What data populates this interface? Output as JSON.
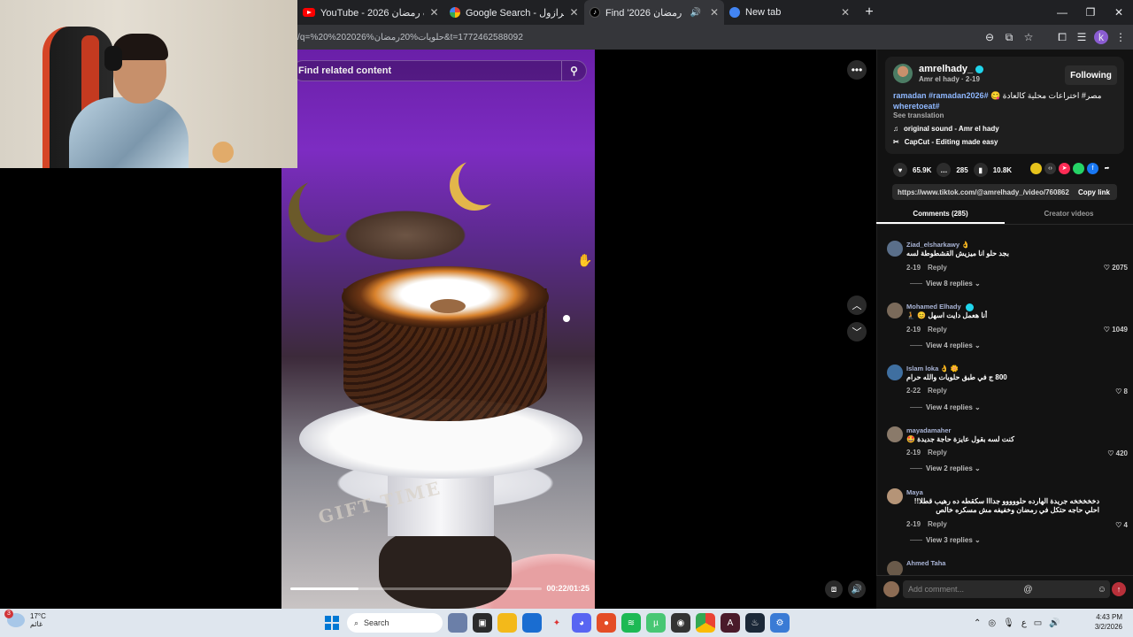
{
  "browser": {
    "tabs": [
      {
        "title": "YouTube - 2026 حلويات رمضان",
        "icon": "youtube-icon",
        "active": false
      },
      {
        "title": "Google Search - داوني برازول",
        "icon": "google-icon",
        "active": false
      },
      {
        "title": "Find '2026 حلويات رمضان '",
        "icon": "tiktok-icon",
        "active": true
      },
      {
        "title": "New tab",
        "icon": "chrome-icon",
        "active": false
      }
    ],
    "url": "/q=%20%202026%حلويات%20رمضان&t=1772462588092"
  },
  "video": {
    "search_placeholder": "Find related content",
    "time": "00:22/01:25",
    "progress": 0.27,
    "overlay_text": "GIFT TIME"
  },
  "post": {
    "username": "amrelhady_",
    "subline": "Amr el hady · 2-19",
    "follow_label": "Following",
    "caption_text": "مصر# اختراعات محلية كالعادة 😋",
    "caption_tags": "#ramadan #ramadan2026",
    "caption_tag2": "#wheretoeat",
    "see_translation": "See translation",
    "sound": "original sound - Amr el hady",
    "capcut": "CapCut - Editing made easy",
    "likes": "65.9K",
    "comments_count": "285",
    "saves": "10.8K",
    "link": "https://www.tiktok.com/@amrelhady_/video/76086238...",
    "copy_link": "Copy link",
    "tab_comments": "Comments (285)",
    "tab_creator": "Creator videos"
  },
  "comments": [
    {
      "name": "Ziad_elsharkawy 👌",
      "text": "بجد حلو انا ميزيش القشطوطة لسه",
      "date": "2-19",
      "reply": "Reply",
      "likes": "2075",
      "view": "View 8 replies",
      "avatar_color": "#5a6f8a"
    },
    {
      "name": "Mohamed Elhady",
      "text": "أنا هعمل دايت اسهل 😊 🧎",
      "date": "2-19",
      "reply": "Reply",
      "likes": "1049",
      "view": "View 4 replies",
      "avatar_color": "#7a6a5a"
    },
    {
      "name": "Islam loka 👌 🌼",
      "text": "800 ج في طبق حلويات والله حرام",
      "date": "2-22",
      "reply": "Reply",
      "likes": "8",
      "view": "View 4 replies",
      "avatar_color": "#3f6fa0"
    },
    {
      "name": "mayadamaher",
      "text": "كنت لسه بقول عايزة حاجة جديدة 🤩",
      "date": "2-19",
      "reply": "Reply",
      "likes": "420",
      "view": "View 2 replies",
      "avatar_color": "#8a7a6a"
    },
    {
      "name": "Maya",
      "text": "دخخخخخه جريدة الهارده حلووووو جدااا سكقطه ده رهيب قطلا!! احلي حاجه حتكل في رمضان وخفيفه مش مسكره خالص",
      "date": "2-19",
      "reply": "Reply",
      "likes": "4",
      "view": "View 3 replies",
      "avatar_color": "#b59477"
    },
    {
      "name": "Ahmed Taha",
      "text": "",
      "date": "",
      "reply": "",
      "likes": "",
      "view": "",
      "avatar_color": "#6a5a4a"
    }
  ],
  "add_comment_placeholder": "Add comment...",
  "taskbar": {
    "temp": "17°C",
    "weather_label": "غائم",
    "weather_badge": "3",
    "search_label": "Search",
    "time": "4:43 PM",
    "date": "3/2/2026",
    "lang": "ع"
  }
}
